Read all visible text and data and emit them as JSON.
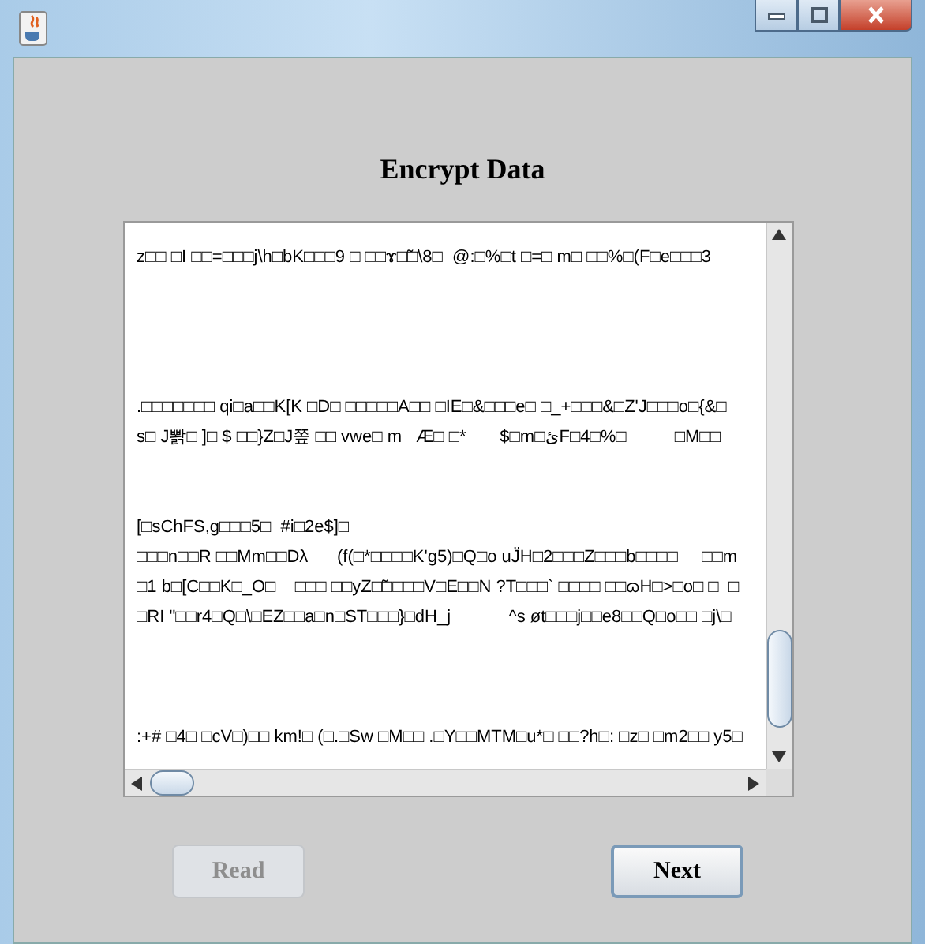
{
  "heading": "Encrypt Data",
  "text_area": {
    "blocks": [
      [
        "z□□ □I □□=□□□j\\h□bK□□□9 □ □□ɤ□̃□\\8□  @:□%□t □=□ m□ □□%□(F□e□□□3"
      ],
      [
        ".□□□□□□□ qi□a□□K[K □D□ □□□□□A□□ □IE□&□□□e□ □_+□□□&□Z'J□□□o□{&□",
        "s□ J뽥□ ]□ $ □□}Z□J쫖 □□ vwe□ m   Æ□ □*       $□m□ئF□4□%□          □M□□"
      ],
      [
        "[□sChFS,g□□□5□  #i□2e$]□",
        "□□□n□□R □□Mm□□Dλ      (f(□*□□□□K'g5)□Q□o uJ̈H□2□□□Z□□□b□□□□     □□m",
        "□1 b□[C□□K□_O□    □□□ □□yZ□̃□□□□V□E□□N ?T□□□` □□□□ □□ɷH□>□o□ □  □",
        "□RI \"□□r4□Q□\\□EZ□□a□n□ST□□□}□dH_j            ^s øt□□□j□□e8□□Q□o□□ □j\\□"
      ],
      [
        ":+# □4□ □cV□)□□ km!□ (□.□Sw □M□□ .□Y□□MTM□u*□ □□?h□: □z□ □m2□□ y5□"
      ]
    ]
  },
  "buttons": [
    {
      "label": "Read",
      "disabled": true
    },
    {
      "label": "Next",
      "disabled": false
    }
  ]
}
